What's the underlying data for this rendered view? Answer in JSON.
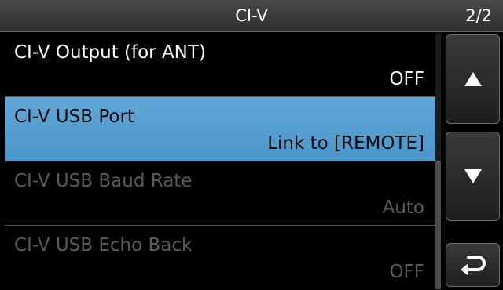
{
  "header": {
    "title": "CI-V",
    "page_indicator": "2/2"
  },
  "items": [
    {
      "label": "CI-V Output (for ANT)",
      "value": "OFF",
      "state": "normal"
    },
    {
      "label": "CI-V USB Port",
      "value": "Link to [REMOTE]",
      "state": "selected"
    },
    {
      "label": "CI-V USB Baud Rate",
      "value": "Auto",
      "state": "disabled"
    },
    {
      "label": "CI-V USB Echo Back",
      "value": "OFF",
      "state": "disabled"
    }
  ],
  "buttons": {
    "up_icon": "triangle-up-icon",
    "down_icon": "triangle-down-icon",
    "back_icon": "return-arrow-icon"
  },
  "colors": {
    "selected_bg": "#5fa8d8",
    "disabled_text": "#5a5a5a"
  }
}
